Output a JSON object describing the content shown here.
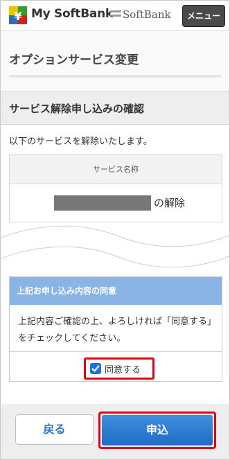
{
  "header": {
    "brand": "My SoftBank",
    "softbank_logo_text": "SoftBank",
    "menu_label": "メニュー"
  },
  "page": {
    "title": "オプションサービス変更"
  },
  "section": {
    "title": "サービス解除申し込みの確認",
    "intro": "以下のサービスを解除いたします。",
    "table_header": "サービス名称",
    "service_suffix": "の解除"
  },
  "consent": {
    "heading": "上記お申し込み内容の同意",
    "text": "上記内容ご確認の上、よろしければ「同意する」をチェックしてください。",
    "agree_label": "同意する",
    "agree_checked": true
  },
  "footer": {
    "back_label": "戻る",
    "submit_label": "申込"
  },
  "colors": {
    "accent_blue": "#2b76c9",
    "highlight_red": "#e3001b",
    "consent_header": "#8ab4e6"
  }
}
